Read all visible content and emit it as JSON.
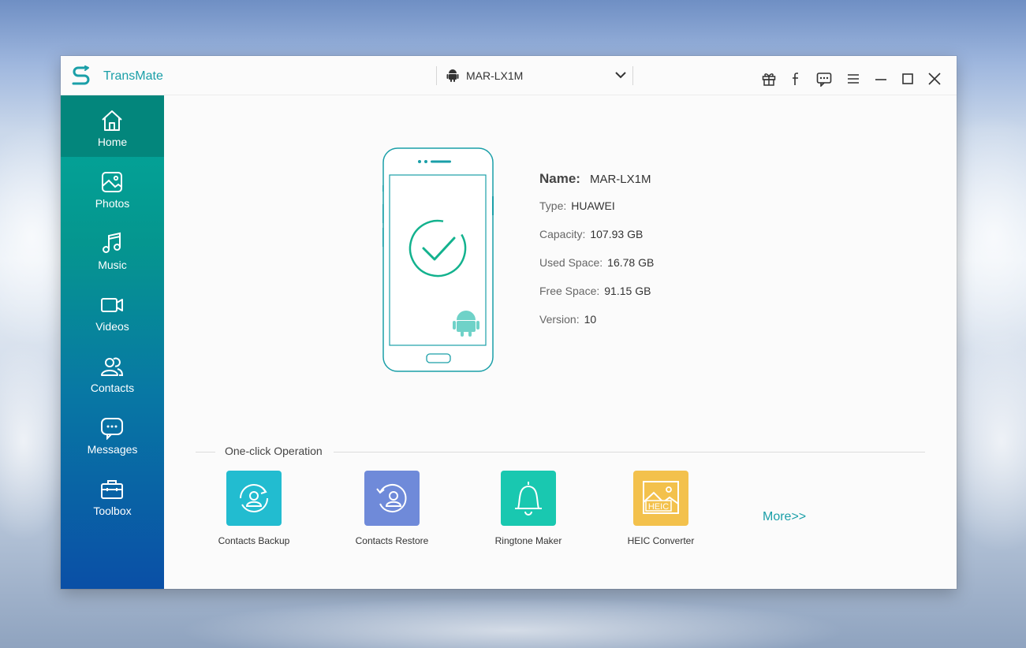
{
  "app": {
    "title": "TransMate"
  },
  "device_selector": {
    "value": "MAR-LX1M"
  },
  "titlebar_icons": [
    "gift-icon",
    "facebook-icon",
    "feedback-icon",
    "menu-icon",
    "minimize-icon",
    "maximize-icon",
    "close-icon"
  ],
  "sidebar": {
    "items": [
      {
        "label": "Home",
        "icon": "home-icon",
        "active": true
      },
      {
        "label": "Photos",
        "icon": "photo-icon"
      },
      {
        "label": "Music",
        "icon": "music-icon"
      },
      {
        "label": "Videos",
        "icon": "video-icon"
      },
      {
        "label": "Contacts",
        "icon": "contacts-icon"
      },
      {
        "label": "Messages",
        "icon": "message-icon"
      },
      {
        "label": "Toolbox",
        "icon": "toolbox-icon"
      }
    ]
  },
  "device_info": {
    "name_label": "Name:",
    "name": "MAR-LX1M",
    "type_label": "Type:",
    "type": "HUAWEI",
    "capacity_label": "Capacity:",
    "capacity": "107.93 GB",
    "used_label": "Used Space:",
    "used": "16.78 GB",
    "free_label": "Free Space:",
    "free": "91.15 GB",
    "version_label": "Version:",
    "version": "10"
  },
  "one_click": {
    "title": "One-click Operation",
    "items": [
      {
        "label": "Contacts Backup",
        "color": "#22bcd0"
      },
      {
        "label": "Contacts Restore",
        "color": "#6f8ad9"
      },
      {
        "label": "Ringtone Maker",
        "color": "#19c8b0"
      },
      {
        "label": "HEIC Converter",
        "color": "#f3c14c",
        "badge": "HEIC"
      }
    ],
    "more": "More>>"
  },
  "colors": {
    "accent": "#1a9fa8",
    "sidebar_active": "#03867c"
  }
}
